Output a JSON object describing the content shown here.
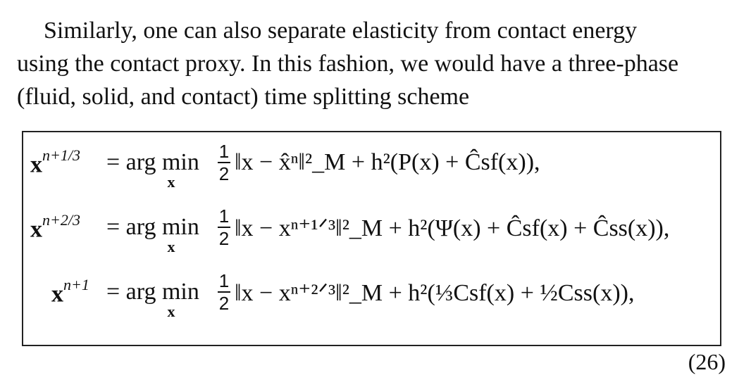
{
  "paragraph": {
    "line1": "Similarly, one can also separate elasticity from contact energy",
    "line2": "using the contact proxy. In this fashion, we would have a three-phase",
    "line3": "(fluid, solid, and contact) time splitting scheme"
  },
  "equations": [
    {
      "lhs_var": "x",
      "lhs_sup": "n+1/3",
      "op": "= arg min",
      "under": "x",
      "frac_num": "1",
      "frac_den": "2",
      "rhs": "‖x − x̂ⁿ‖²_M + h²(P(x) + Ĉsf(x)),"
    },
    {
      "lhs_var": "x",
      "lhs_sup": "n+2/3",
      "op": "= arg min",
      "under": "x",
      "frac_num": "1",
      "frac_den": "2",
      "rhs": "‖x − xⁿ⁺¹ᐟ³‖²_M + h²(Ψ(x) + Ĉsf(x) + Ĉss(x)),"
    },
    {
      "lhs_var": "x",
      "lhs_sup": "n+1",
      "op": "= arg min",
      "under": "x",
      "frac_num": "1",
      "frac_den": "2",
      "rhs": "‖x − xⁿ⁺²ᐟ³‖²_M + h²(⅓Csf(x) + ½Css(x)),"
    }
  ],
  "equation_number": "(26)"
}
